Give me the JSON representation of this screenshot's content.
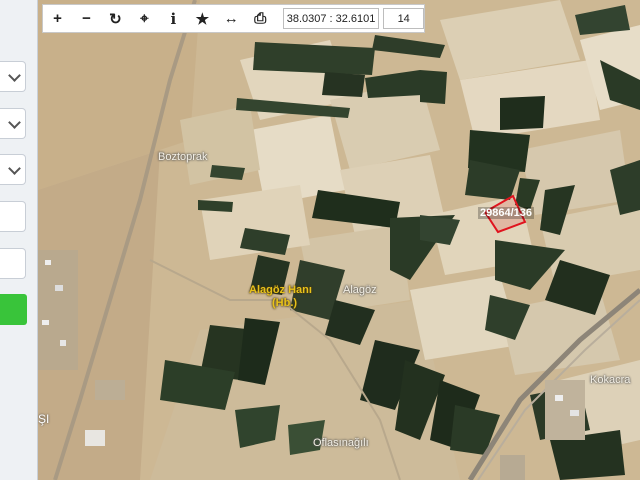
{
  "toolbar": {
    "buttons": [
      {
        "icon": "zoom-in-icon",
        "glyph": "+"
      },
      {
        "icon": "zoom-out-icon",
        "glyph": "−"
      },
      {
        "icon": "refresh-icon",
        "glyph": "↻"
      },
      {
        "icon": "locate-icon",
        "glyph": "⌖"
      },
      {
        "icon": "info-icon",
        "glyph": "i"
      },
      {
        "icon": "star-icon",
        "glyph": "★"
      },
      {
        "icon": "measure-icon",
        "glyph": "↔"
      },
      {
        "icon": "print-icon",
        "glyph": "⎙"
      }
    ],
    "coordinates": "38.0307 : 32.6101",
    "zoom": "14"
  },
  "map": {
    "labels": {
      "boztoprak": "Boztoprak",
      "alagoz_hani": "Alagöz Hanı",
      "alagoz_hani_suffix": "(Hb.)",
      "alagoz": "Alagöz",
      "parcel": "29864/136",
      "flasinagili": "Oflasınağılı",
      "kokacra": "Kokacra",
      "edge_left": "ŞI"
    }
  },
  "colors": {
    "toolbar_bg": "#ffffff",
    "panel_bg": "#eef1f4",
    "green_button": "#39c43a",
    "parcel_outline": "#e0141e",
    "town_label": "#e8c21a"
  }
}
